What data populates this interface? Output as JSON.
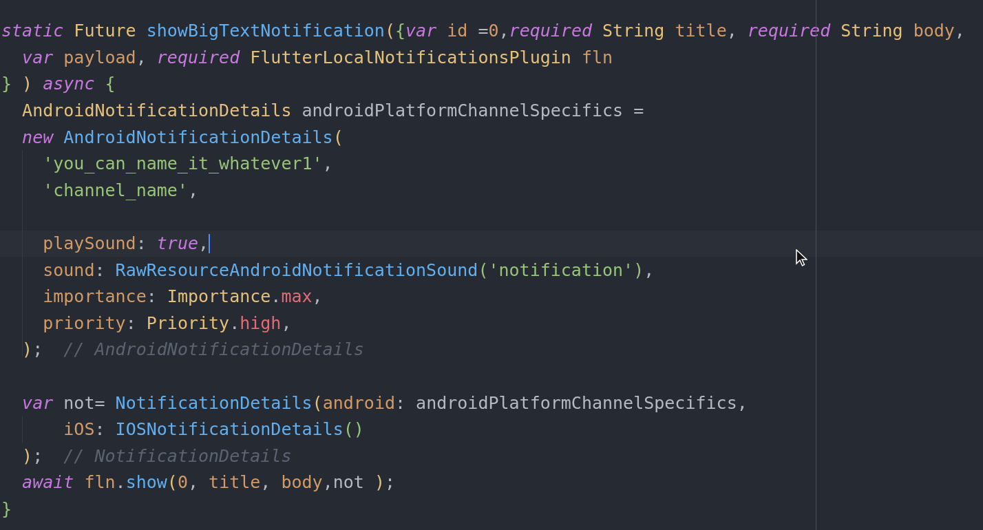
{
  "editor": {
    "lines": [
      {
        "current": false,
        "tokens": [
          {
            "text": "static ",
            "kind": "kw"
          },
          {
            "text": "Future ",
            "kind": "type"
          },
          {
            "text": "showBigTextNotification",
            "kind": "fn"
          },
          {
            "text": "(",
            "kind": "paren"
          },
          {
            "text": "{",
            "kind": "brace"
          },
          {
            "text": "var ",
            "kind": "kw"
          },
          {
            "text": "id",
            "kind": "param"
          },
          {
            "text": " =",
            "kind": "plain"
          },
          {
            "text": "0",
            "kind": "param"
          },
          {
            "text": ",",
            "kind": "plain"
          },
          {
            "text": "required ",
            "kind": "kw"
          },
          {
            "text": "String ",
            "kind": "type"
          },
          {
            "text": "title",
            "kind": "param"
          },
          {
            "text": ", ",
            "kind": "plain"
          },
          {
            "text": "required ",
            "kind": "kw"
          },
          {
            "text": "String ",
            "kind": "type"
          },
          {
            "text": "body",
            "kind": "param"
          },
          {
            "text": ",",
            "kind": "plain"
          }
        ]
      },
      {
        "current": false,
        "tokens": [
          {
            "text": "  var ",
            "kind": "kw"
          },
          {
            "text": "payload",
            "kind": "param"
          },
          {
            "text": ", ",
            "kind": "plain"
          },
          {
            "text": "required ",
            "kind": "kw"
          },
          {
            "text": "FlutterLocalNotificationsPlugin ",
            "kind": "type"
          },
          {
            "text": "fln",
            "kind": "param"
          }
        ]
      },
      {
        "current": false,
        "tokens": [
          {
            "text": "} ",
            "kind": "brace"
          },
          {
            "text": ") ",
            "kind": "paren"
          },
          {
            "text": "async ",
            "kind": "kw"
          },
          {
            "text": "{",
            "kind": "brace"
          }
        ]
      },
      {
        "current": false,
        "tokens": [
          {
            "text": "  AndroidNotificationDetails",
            "kind": "type"
          },
          {
            "text": " androidPlatformChannelSpecifics =",
            "kind": "plain"
          }
        ]
      },
      {
        "current": false,
        "tokens": [
          {
            "text": "  new ",
            "kind": "kw"
          },
          {
            "text": "AndroidNotificationDetails",
            "kind": "fn"
          },
          {
            "text": "(",
            "kind": "paren"
          }
        ]
      },
      {
        "current": false,
        "tokens": [
          {
            "text": "    'you_can_name_it_whatever1'",
            "kind": "str"
          },
          {
            "text": ",",
            "kind": "plain"
          }
        ]
      },
      {
        "current": false,
        "tokens": [
          {
            "text": "    'channel_name'",
            "kind": "str"
          },
          {
            "text": ",",
            "kind": "plain"
          }
        ]
      },
      {
        "current": false
      },
      {
        "current": true,
        "tokens": [
          {
            "text": "    playSound",
            "kind": "param"
          },
          {
            "text": ": ",
            "kind": "plain"
          },
          {
            "text": "true",
            "kind": "kw"
          },
          {
            "text": ",",
            "kind": "plain"
          }
        ]
      },
      {
        "current": false,
        "tokens": [
          {
            "text": "    sound",
            "kind": "param"
          },
          {
            "text": ": ",
            "kind": "plain"
          },
          {
            "text": "RawResourceAndroidNotificationSound",
            "kind": "fn"
          },
          {
            "text": "(",
            "kind": "paren2"
          },
          {
            "text": "'notification'",
            "kind": "str"
          },
          {
            "text": ")",
            "kind": "paren2"
          },
          {
            "text": ",",
            "kind": "plain"
          }
        ]
      },
      {
        "current": false,
        "tokens": [
          {
            "text": "    importance",
            "kind": "param"
          },
          {
            "text": ": ",
            "kind": "plain"
          },
          {
            "text": "Importance",
            "kind": "type"
          },
          {
            "text": ".",
            "kind": "plain"
          },
          {
            "text": "max",
            "kind": "enum"
          },
          {
            "text": ",",
            "kind": "plain"
          }
        ]
      },
      {
        "current": false,
        "tokens": [
          {
            "text": "    priority",
            "kind": "param"
          },
          {
            "text": ": ",
            "kind": "plain"
          },
          {
            "text": "Priority",
            "kind": "type"
          },
          {
            "text": ".",
            "kind": "plain"
          },
          {
            "text": "high",
            "kind": "enum"
          },
          {
            "text": ",",
            "kind": "plain"
          }
        ]
      },
      {
        "current": false,
        "tokens": [
          {
            "text": "  )",
            "kind": "paren"
          },
          {
            "text": ";  ",
            "kind": "plain"
          },
          {
            "text": "// AndroidNotificationDetails",
            "kind": "comment"
          }
        ]
      },
      {
        "current": false
      },
      {
        "current": false,
        "tokens": [
          {
            "text": "  var ",
            "kind": "kw"
          },
          {
            "text": "not= ",
            "kind": "plain"
          },
          {
            "text": "NotificationDetails",
            "kind": "fn"
          },
          {
            "text": "(",
            "kind": "paren"
          },
          {
            "text": "android",
            "kind": "param"
          },
          {
            "text": ": androidPlatformChannelSpecifics,",
            "kind": "plain"
          }
        ]
      },
      {
        "current": false,
        "tokens": [
          {
            "text": "      iOS",
            "kind": "param"
          },
          {
            "text": ": ",
            "kind": "plain"
          },
          {
            "text": "IOSNotificationDetails",
            "kind": "fn"
          },
          {
            "text": "()",
            "kind": "paren2"
          }
        ]
      },
      {
        "current": false,
        "tokens": [
          {
            "text": "  )",
            "kind": "paren"
          },
          {
            "text": ";  ",
            "kind": "plain"
          },
          {
            "text": "// NotificationDetails",
            "kind": "comment"
          }
        ]
      },
      {
        "current": false,
        "tokens": [
          {
            "text": "  await ",
            "kind": "kw"
          },
          {
            "text": "fln",
            "kind": "param"
          },
          {
            "text": ".",
            "kind": "plain"
          },
          {
            "text": "show",
            "kind": "fn"
          },
          {
            "text": "(",
            "kind": "paren"
          },
          {
            "text": "0",
            "kind": "param"
          },
          {
            "text": ", ",
            "kind": "plain"
          },
          {
            "text": "title",
            "kind": "param"
          },
          {
            "text": ", ",
            "kind": "plain"
          },
          {
            "text": "body",
            "kind": "param"
          },
          {
            "text": ",not ",
            "kind": "plain"
          },
          {
            "text": ")",
            "kind": "paren"
          },
          {
            "text": ";",
            "kind": "plain"
          }
        ]
      },
      {
        "current": false,
        "tokens": [
          {
            "text": "}",
            "kind": "brace"
          }
        ]
      }
    ]
  }
}
